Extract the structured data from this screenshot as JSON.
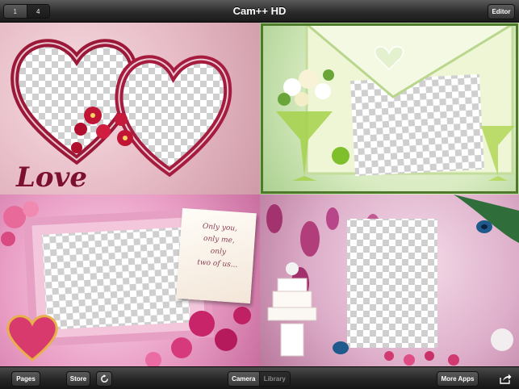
{
  "topbar": {
    "seg_left": "1",
    "seg_right": "4",
    "title": "Cam++ HD",
    "editor_label": "Editor"
  },
  "tiles": {
    "tile1": {
      "text": "Love"
    },
    "tile3": {
      "note_lines": [
        "Only you,",
        "only me,",
        "only",
        "two of us..."
      ]
    }
  },
  "bottombar": {
    "pages_label": "Pages",
    "store_label": "Store",
    "refresh_icon": "refresh-icon",
    "camera_label": "Camera",
    "library_label": "Library",
    "more_apps_label": "More Apps",
    "share_icon": "share-icon"
  },
  "colors": {
    "bar": "#2c2c2c",
    "selection": "#4f7a2c"
  }
}
